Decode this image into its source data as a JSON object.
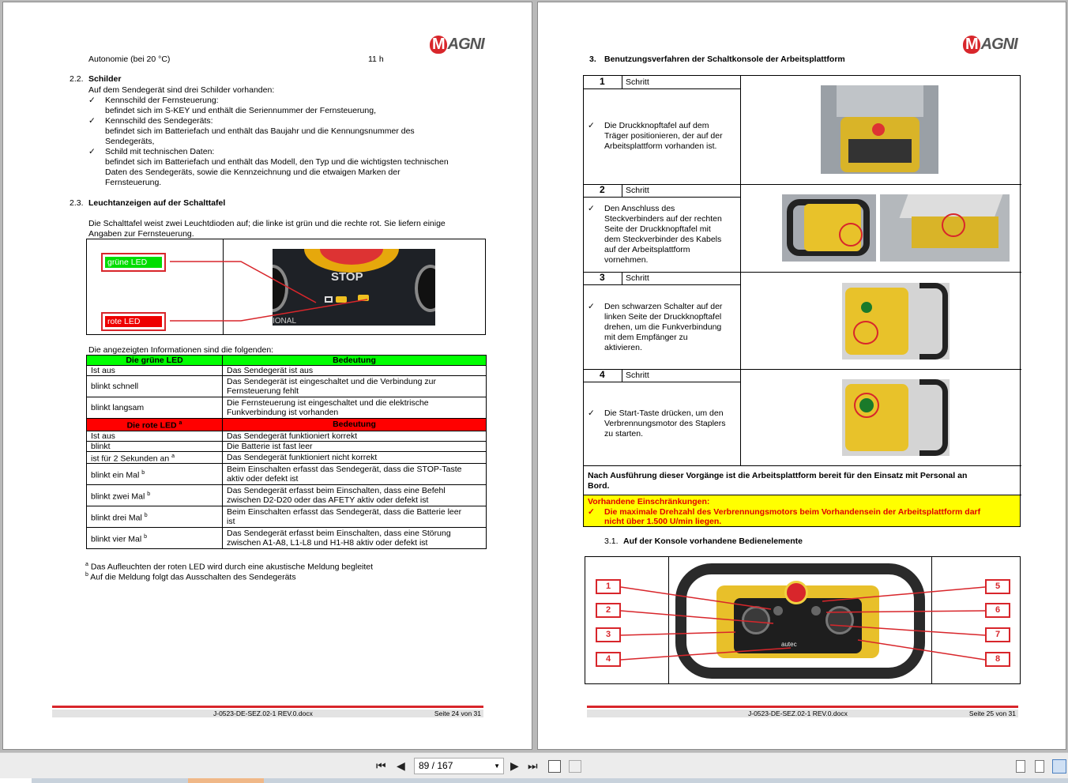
{
  "left_page": {
    "autonomy_label": "Autonomie (bei 20 °C)",
    "autonomy_value": "11 h",
    "s22_num": "2.2.",
    "s22_title": "Schilder",
    "s22_intro": "Auf dem Sendegerät sind drei Schilder vorhanden:",
    "check": "✓",
    "s22_items": [
      {
        "title": "Kennschild der Fernsteuerung:",
        "lines": [
          "befindet sich im S-KEY und enthält die Seriennummer der Fernsteuerung,"
        ]
      },
      {
        "title": "Kennschild des Sendegeräts:",
        "lines": [
          "befindet sich im Batteriefach und enthält das Baujahr und die Kennungsnummer des",
          "Sendegeräts,"
        ]
      },
      {
        "title": "Schild mit technischen Daten:",
        "lines": [
          "befindet sich im Batteriefach und enthält das Modell, den Typ und die wichtigsten technischen",
          "Daten des Sendegeräts, sowie die Kennzeichnung und die etwaigen Marken der",
          "Fernsteuerung."
        ]
      }
    ],
    "s23_num": "2.3.",
    "s23_title": "Leuchtanzeigen auf der Schalttafel",
    "s23_p1": "Die Schalttafel weist zwei Leuchtdioden auf; die linke ist grün und die rechte rot. Sie liefern einige",
    "s23_p2": "Angaben zur Fernsteuerung.",
    "led_green_label": "grüne LED",
    "led_red_label": "rote LED",
    "stop_label": "STOP",
    "panel_text": "IONAL",
    "info_intro": "Die angezeigten Informationen sind die folgenden:",
    "green_header": [
      "Die grüne LED",
      "Bedeutung"
    ],
    "green_rows": [
      [
        "Ist aus",
        "Das Sendegerät ist aus"
      ],
      [
        "blinkt schnell",
        "Das Sendegerät ist eingeschaltet und die Verbindung zur",
        "Fernsteuerung fehlt"
      ],
      [
        "blinkt langsam",
        "Die Fernsteuerung ist eingeschaltet und die elektrische",
        "Funkverbindung ist vorhanden"
      ]
    ],
    "red_header": [
      "Die rote LED",
      "a",
      "Bedeutung"
    ],
    "red_rows": [
      [
        "Ist aus",
        "",
        "Das Sendegerät funktioniert korrekt",
        ""
      ],
      [
        "blinkt",
        "",
        "Die Batterie ist fast leer",
        ""
      ],
      [
        "ist für 2 Sekunden an",
        "a",
        "Das Sendegerät funktioniert nicht korrekt",
        ""
      ],
      [
        "blinkt ein Mal",
        "b",
        "Beim Einschalten erfasst das Sendegerät, dass die STOP-Taste",
        "aktiv oder defekt ist"
      ],
      [
        "blinkt zwei Mal",
        "b",
        "Das Sendegerät erfasst beim Einschalten, dass eine Befehl",
        "zwischen D2-D20 oder das AFETY aktiv oder defekt ist"
      ],
      [
        "blinkt drei Mal",
        "b",
        "Beim Einschalten erfasst das Sendegerät, dass die Batterie leer",
        "ist"
      ],
      [
        "blinkt vier Mal",
        "b",
        "Das Sendegerät erfasst beim Einschalten, dass eine Störung",
        "zwischen A1-A8, L1-L8 und H1-H8 aktiv oder defekt ist"
      ]
    ],
    "fn_a_mark": "a",
    "fn_a": "Das Aufleuchten der roten LED wird durch eine akustische Meldung begleitet",
    "fn_b_mark": "b",
    "fn_b": "Auf die Meldung folgt das Ausschalten des Sendegeräts",
    "footer_doc": "J-0523-DE-SEZ.02-1 REV.0.docx",
    "footer_page": "Seite 24 von 31"
  },
  "right_page": {
    "s3_num": "3.",
    "s3_title": "Benutzungsverfahren der Schaltkonsole der Arbeitsplattform",
    "step_word": "Schritt",
    "steps": [
      {
        "n": "1",
        "lines": [
          "Die Druckknopftafel auf dem",
          "Träger positionieren, der auf der",
          "Arbeitsplattform vorhanden ist."
        ]
      },
      {
        "n": "2",
        "lines": [
          "Den Anschluss des",
          "Steckverbinders auf der rechten",
          "Seite der Druckknopftafel mit",
          "dem Steckverbinder des Kabels",
          "auf der Arbeitsplattform",
          "vornehmen."
        ]
      },
      {
        "n": "3",
        "lines": [
          "Den schwarzen Schalter auf der",
          "linken Seite der Druckknopftafel",
          "drehen, um die Funkverbindung",
          "mit dem Empfänger zu",
          "aktivieren."
        ]
      },
      {
        "n": "4",
        "lines": [
          "Die Start-Taste drücken, um den",
          "Verbrennungsmotor des Staplers",
          "zu starten."
        ]
      }
    ],
    "after_1": "Nach Ausführung dieser Vorgänge ist die Arbeitsplattform bereit für den Einsatz mit Personal an",
    "after_2": "Bord.",
    "restr_title": "Vorhandene Einschränkungen:",
    "restr_1": "Die maximale Drehzahl des Verbrennungsmotors beim Vorhandensein der Arbeitsplattform darf",
    "restr_2": "nicht über 1.500 U/min liegen.",
    "s31_num": "3.1.",
    "s31_title": "Auf der Konsole vorhandene Bedienelemente",
    "callouts_left": [
      "1",
      "2",
      "3",
      "4"
    ],
    "callouts_right": [
      "5",
      "6",
      "7",
      "8"
    ],
    "autec_label": "autec",
    "footer_doc": "J-0523-DE-SEZ.02-1 REV.0.docx",
    "footer_page": "Seite 25 von 31"
  },
  "logo_text": "AGNI",
  "logo_m": "M",
  "toolbar": {
    "page_field": "89 / 167"
  },
  "colors": {
    "brand_red": "#d8262b",
    "green_header": "#00ff00",
    "red_header": "#ff0000",
    "warning_yellow": "#ffff00"
  }
}
